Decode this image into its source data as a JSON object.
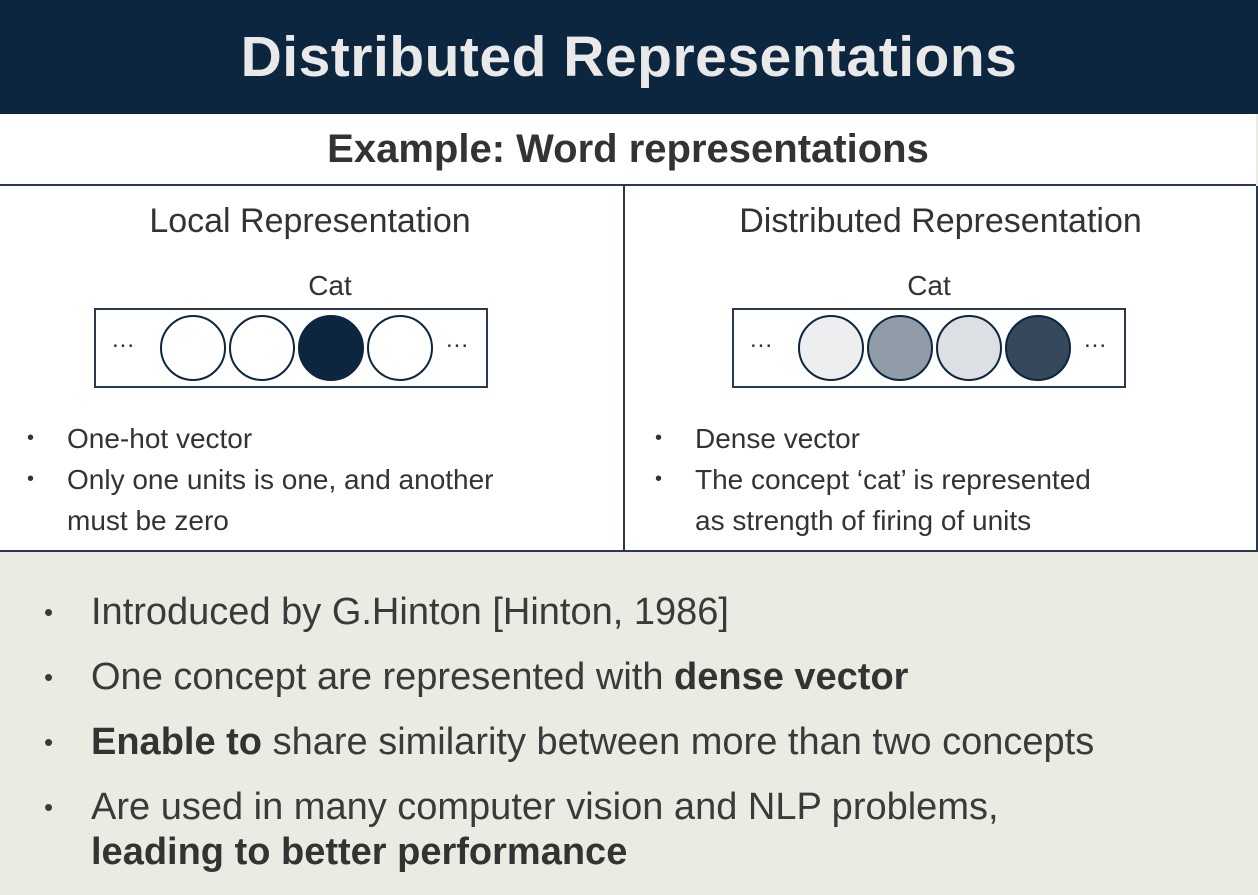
{
  "title": "Distributed Representations",
  "subtitle": "Example: Word representations",
  "local": {
    "heading": "Local Representation",
    "word": "Cat",
    "ellipsis_left": "...",
    "ellipsis_right": "...",
    "units": [
      "#ffffff",
      "#ffffff",
      "#0d2640",
      "#ffffff"
    ],
    "bullets": [
      "One-hot vector",
      "Only one units is one, and another",
      "must be zero"
    ]
  },
  "distributed": {
    "heading": "Distributed Representation",
    "word": "Cat",
    "ellipsis_left": "...",
    "ellipsis_right": "...",
    "units": [
      "#eceef0",
      "#909ca7",
      "#dcdfe3",
      "#36495c"
    ],
    "bullets": [
      "Dense vector",
      "The concept ‘cat’ is represented",
      "as strength of firing of units"
    ]
  },
  "points": [
    {
      "pre": "Introduced by G.Hinton [Hinton, 1986]",
      "bold": "",
      "post": ""
    },
    {
      "pre": "One concept are represented with ",
      "bold": "dense vector",
      "post": ""
    },
    {
      "pre": "",
      "bold": "Enable to",
      "post": " share similarity between more than two concepts"
    },
    {
      "pre": "Are used in many computer vision and NLP problems,",
      "bold": "leading to better performance",
      "post": ""
    }
  ],
  "bullet_glyph": "•",
  "colors": {
    "title_bar": "#0d2640",
    "bottom_bg": "#ecebe3"
  }
}
